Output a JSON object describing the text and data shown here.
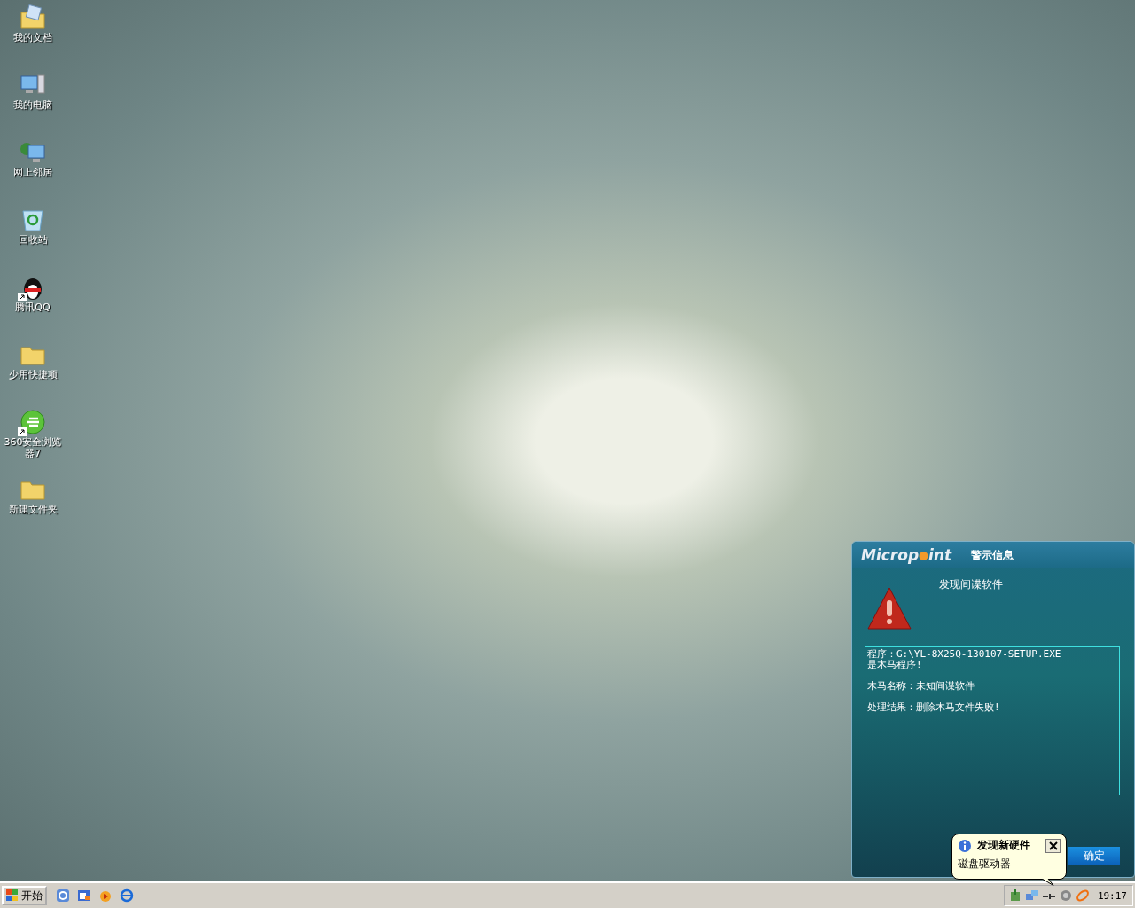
{
  "desktop_icons": [
    {
      "kind": "documents",
      "label": "我的文档",
      "shortcut": false
    },
    {
      "kind": "computer",
      "label": "我的电脑",
      "shortcut": false
    },
    {
      "kind": "network",
      "label": "网上邻居",
      "shortcut": false
    },
    {
      "kind": "recycle",
      "label": "回收站",
      "shortcut": false
    },
    {
      "kind": "penguin",
      "label": "腾讯QQ",
      "shortcut": true
    },
    {
      "kind": "folder",
      "label": "少用快捷项",
      "shortcut": false
    },
    {
      "kind": "browser",
      "label": "360安全浏览器7",
      "shortcut": true
    },
    {
      "kind": "folder",
      "label": "新建文件夹",
      "shortcut": false
    }
  ],
  "alert_window": {
    "logo": [
      "Microp",
      "int"
    ],
    "title": "警示信息",
    "heading": "发现间谍软件",
    "report": [
      [
        "程序：G:\\YL-8X25Q-130107-SETUP.EXE",
        "是木马程序!"
      ],
      [
        "木马名称：未知间谍软件"
      ],
      [
        "处理结果：删除木马文件失败!"
      ]
    ],
    "ok_button": "确定"
  },
  "balloon": {
    "title": "发现新硬件",
    "message": "磁盘驱动器"
  },
  "taskbar": {
    "start_button": "开始",
    "quick_launch": [
      {
        "kind": "edit"
      },
      {
        "kind": "window"
      },
      {
        "kind": "media"
      },
      {
        "kind": "ie"
      }
    ],
    "tray_icons": [
      {
        "kind": "usb"
      },
      {
        "kind": "network"
      },
      {
        "kind": "plug"
      },
      {
        "kind": "speaker"
      },
      {
        "kind": "link"
      }
    ],
    "clock": "19:17"
  }
}
